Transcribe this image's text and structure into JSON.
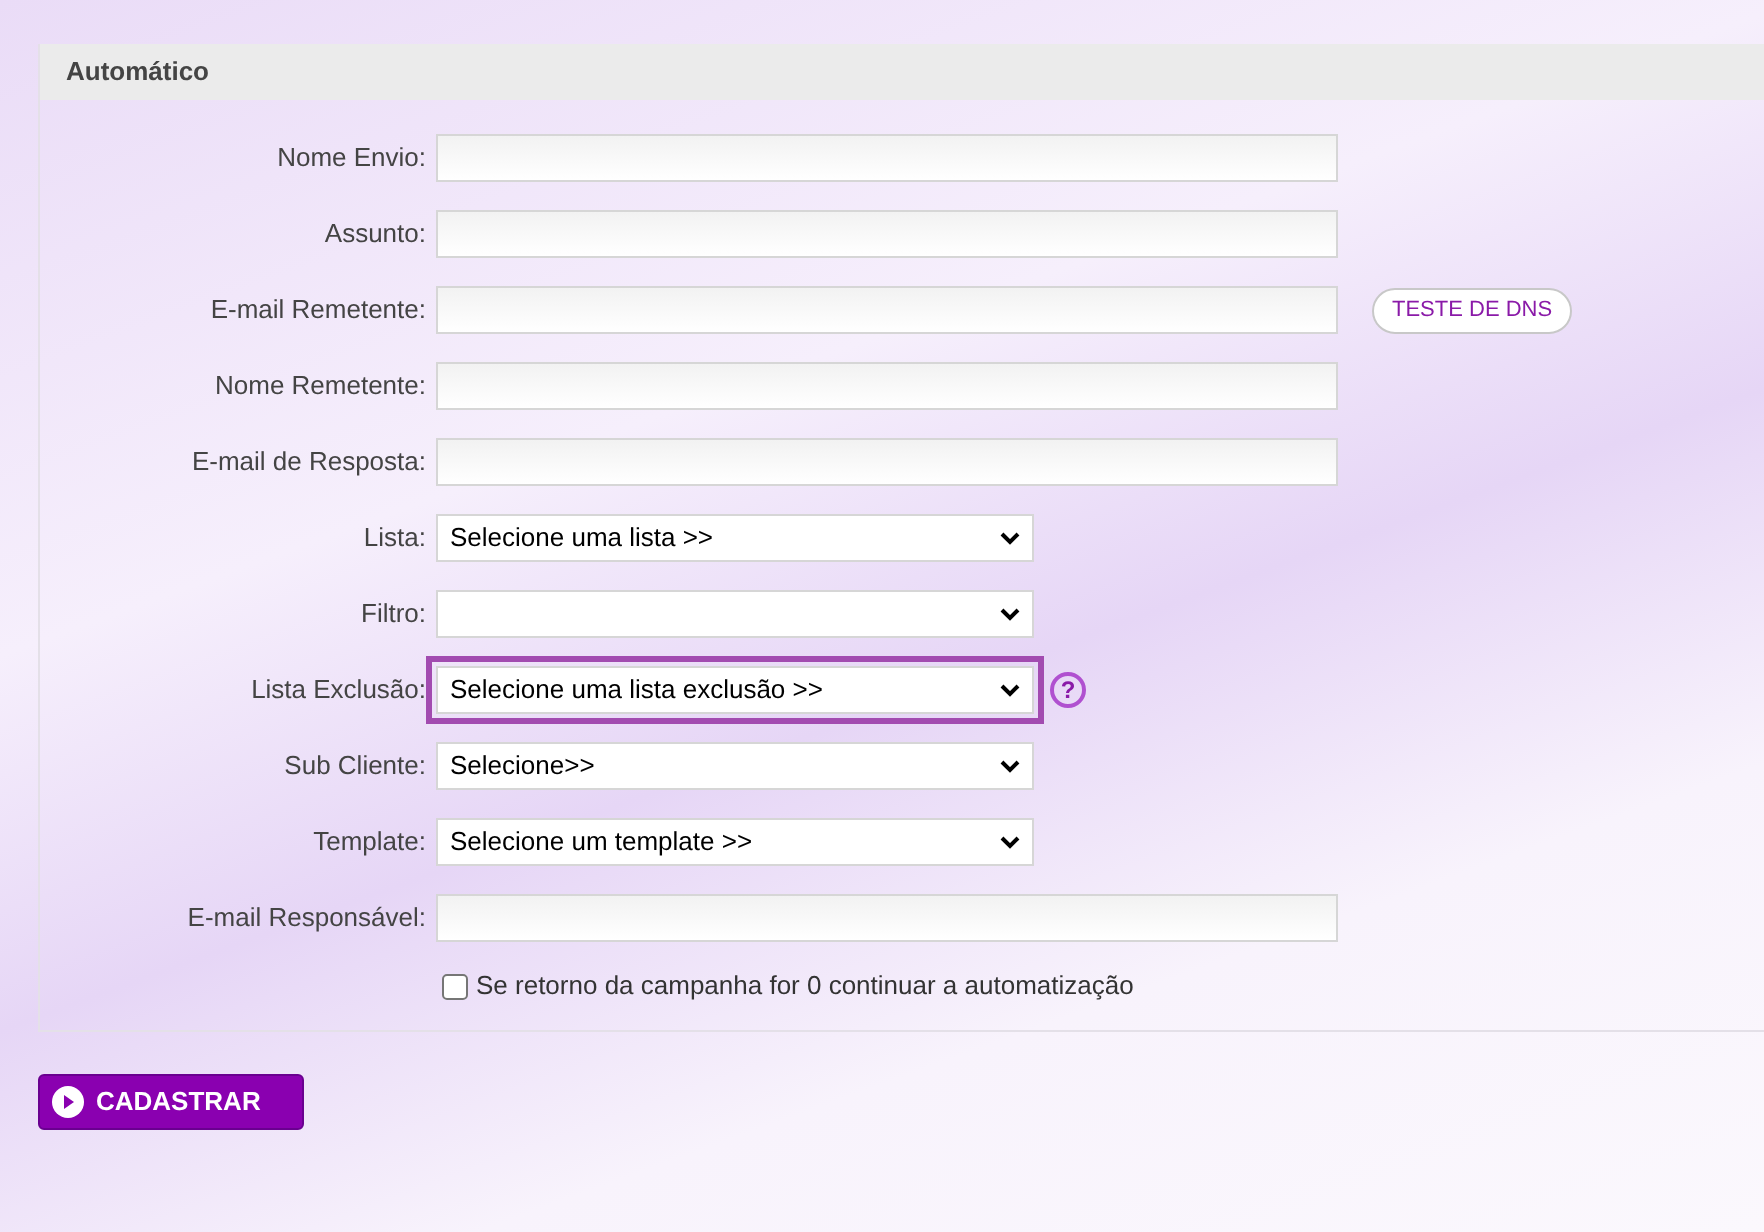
{
  "section": {
    "title": "Automático"
  },
  "fields": [
    {
      "kind": "text",
      "label": "Nome Envio:"
    },
    {
      "kind": "text",
      "label": "Assunto:"
    },
    {
      "kind": "text",
      "label": "E-mail Remetente:",
      "button": "TESTE DE DNS"
    },
    {
      "kind": "text",
      "label": "Nome Remetente:"
    },
    {
      "kind": "text",
      "label": "E-mail de Resposta:"
    },
    {
      "kind": "select",
      "label": "Lista:",
      "value": "Selecione uma lista >>",
      "highlighted": false
    },
    {
      "kind": "select",
      "label": "Filtro:",
      "highlighted": false
    },
    {
      "kind": "select",
      "label": "Lista Exclusão:",
      "value": "Selecione uma lista exclusão >>",
      "highlighted": true,
      "help": "?"
    },
    {
      "kind": "select",
      "label": "Sub Cliente:",
      "value": "Selecione>>",
      "highlighted": false
    },
    {
      "kind": "select",
      "label": "Template:",
      "value": "Selecione um template >>",
      "highlighted": false
    },
    {
      "kind": "text",
      "label": "E-mail Responsável:"
    }
  ],
  "checkbox": {
    "label": "Se retorno da campanha for 0 continuar a automatização",
    "checked": false
  },
  "submit": {
    "label": "CADASTRAR"
  }
}
